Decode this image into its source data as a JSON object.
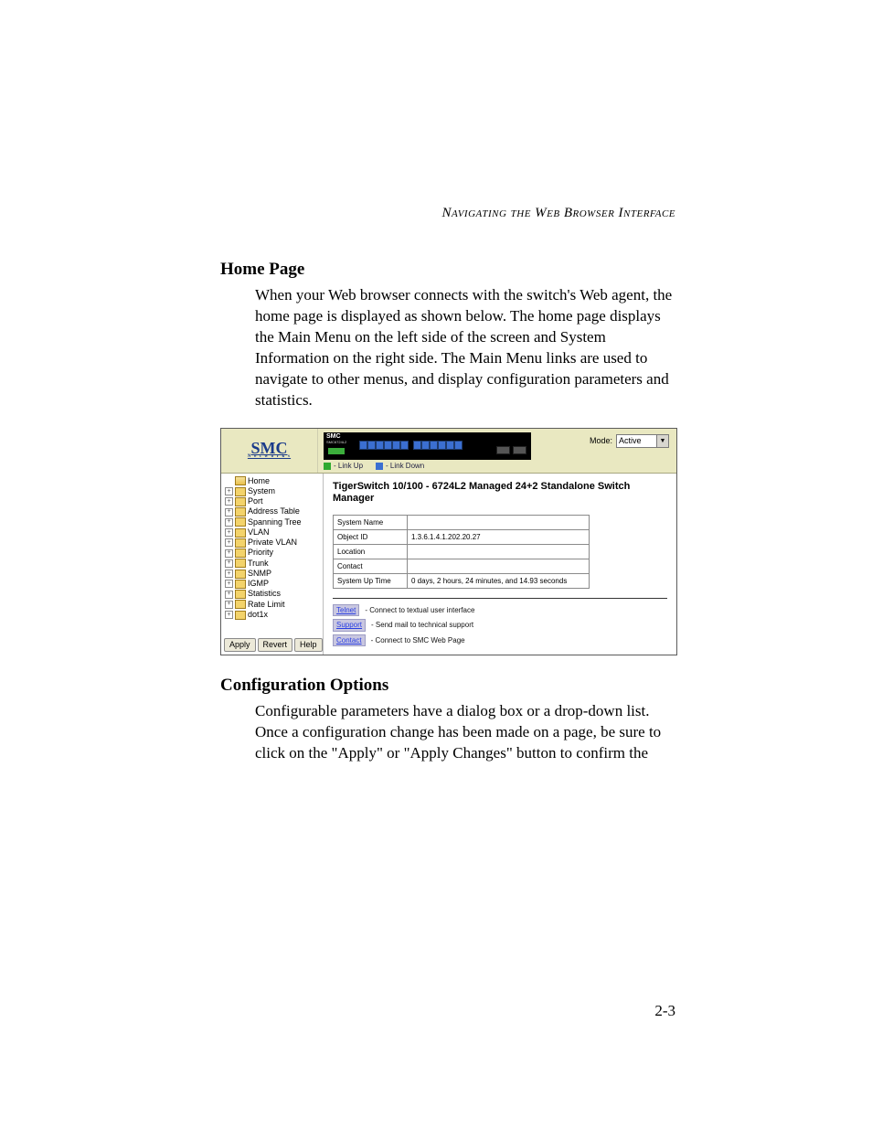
{
  "runningHead": "Navigating the Web Browser Interface",
  "pageNumber": "2-3",
  "section1": {
    "title": "Home Page",
    "para": "When your Web browser connects with the switch's Web agent, the home page is displayed as shown below. The home page displays the Main Menu on the left side of the screen and System Information on the right side. The Main Menu links are used to navigate to other menus, and display configuration parameters and statistics."
  },
  "section2": {
    "title": "Configuration Options",
    "para": "Configurable parameters have a dialog box or a drop-down list. Once a configuration change has been made on a page, be sure to click on the \"Apply\" or \"Apply Changes\" button to confirm the"
  },
  "app": {
    "brand": "SMC",
    "brandSub": "N e t w o r k s",
    "switchLabel": "SMC",
    "switchModel": "SMC6724L2",
    "legendUp": "- Link Up",
    "legendDown": "- Link Down",
    "modeLabel": "Mode:",
    "modeValue": "Active",
    "tree": [
      {
        "label": "Home",
        "expandable": false,
        "open": true
      },
      {
        "label": "System",
        "expandable": true
      },
      {
        "label": "Port",
        "expandable": true
      },
      {
        "label": "Address Table",
        "expandable": true
      },
      {
        "label": "Spanning Tree",
        "expandable": true
      },
      {
        "label": "VLAN",
        "expandable": true
      },
      {
        "label": "Private VLAN",
        "expandable": true
      },
      {
        "label": "Priority",
        "expandable": true
      },
      {
        "label": "Trunk",
        "expandable": true
      },
      {
        "label": "SNMP",
        "expandable": true
      },
      {
        "label": "IGMP",
        "expandable": true
      },
      {
        "label": "Statistics",
        "expandable": true
      },
      {
        "label": "Rate Limit",
        "expandable": true
      },
      {
        "label": "dot1x",
        "expandable": true
      }
    ],
    "buttons": {
      "apply": "Apply",
      "revert": "Revert",
      "help": "Help"
    },
    "mainTitle": "TigerSwitch 10/100 - 6724L2 Managed 24+2 Standalone Switch Manager",
    "fields": {
      "systemName": {
        "label": "System Name",
        "value": ""
      },
      "objectId": {
        "label": "Object ID",
        "value": "1.3.6.1.4.1.202.20.27"
      },
      "location": {
        "label": "Location",
        "value": ""
      },
      "contact": {
        "label": "Contact",
        "value": ""
      },
      "uptime": {
        "label": "System Up Time",
        "value": "0 days, 2 hours, 24 minutes, and 14.93 seconds"
      }
    },
    "links": {
      "telnet": {
        "label": "Telnet",
        "desc": "- Connect to textual user interface"
      },
      "support": {
        "label": "Support",
        "desc": "- Send mail to technical support"
      },
      "contact": {
        "label": "Contact",
        "desc": "- Connect to SMC Web Page"
      }
    }
  }
}
